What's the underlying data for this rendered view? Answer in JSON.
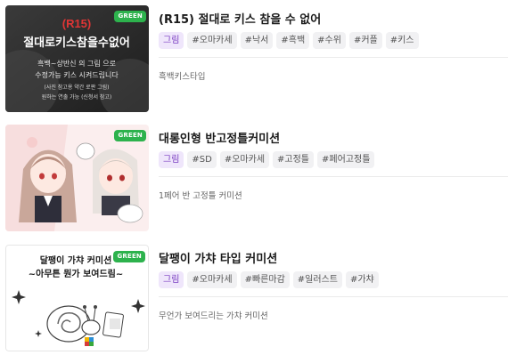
{
  "items": [
    {
      "badge": "GREEN",
      "title": "(R15) 절대로 키스 참을 수 없어",
      "tags": [
        "그림",
        "#오마카세",
        "#낙서",
        "#흑백",
        "#수위",
        "#커플",
        "#키스"
      ],
      "desc": "흑백키스타입",
      "thumb_text": {
        "line1": "(R15)",
        "line2": "절대로키스참을수없어",
        "line3": "흑백~상반신 의 그림 으로",
        "line4": "수정가능 키스 시켜드립니다",
        "line5": "(사진 참고용 약간 로판 그림)",
        "line6": "원하는 연출 가능 (신청서 참고)"
      }
    },
    {
      "badge": "GREEN",
      "title": "대롱인형 반고정틀커미션",
      "tags": [
        "그림",
        "#SD",
        "#오마카세",
        "#고정틀",
        "#페어고정틀"
      ],
      "desc": "1페어 반 고정틀 커미션"
    },
    {
      "badge": "GREEN",
      "title": "달팽이 가챠 타입 커미션",
      "tags": [
        "그림",
        "#오마카세",
        "#빠른마감",
        "#일러스트",
        "#가챠"
      ],
      "desc": "무언가 보여드리는 가챠 커미션",
      "thumb_text": {
        "line1": "달팽이 가챠 커미션",
        "line2": "~아무튼 뭔가 보여드림~"
      }
    }
  ],
  "colors": {
    "badge": "#2db24d",
    "category_tag_bg": "#efe6fb",
    "category_tag_text": "#7b3fc2",
    "tag_bg": "#f1f1f3",
    "r15_red": "#e03535"
  }
}
